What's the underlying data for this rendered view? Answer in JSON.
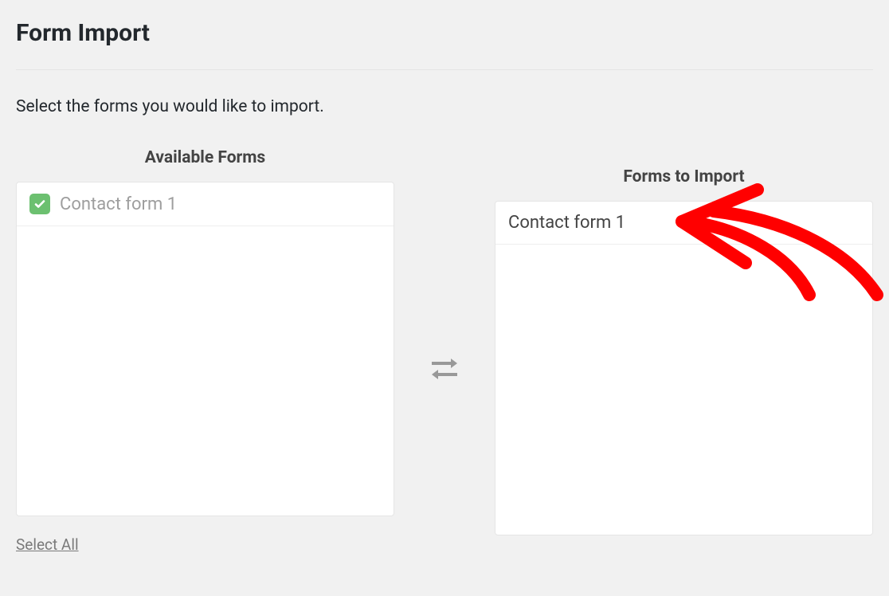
{
  "title": "Form Import",
  "subtitle": "Select the forms you would like to import.",
  "columns": {
    "available": {
      "heading": "Available Forms",
      "items": [
        {
          "label": "Contact form 1",
          "checked": true
        }
      ]
    },
    "to_import": {
      "heading": "Forms to Import",
      "items": [
        {
          "label": "Contact form 1"
        }
      ]
    }
  },
  "select_all_label": "Select All",
  "annotation": {
    "color": "#ff0000"
  }
}
